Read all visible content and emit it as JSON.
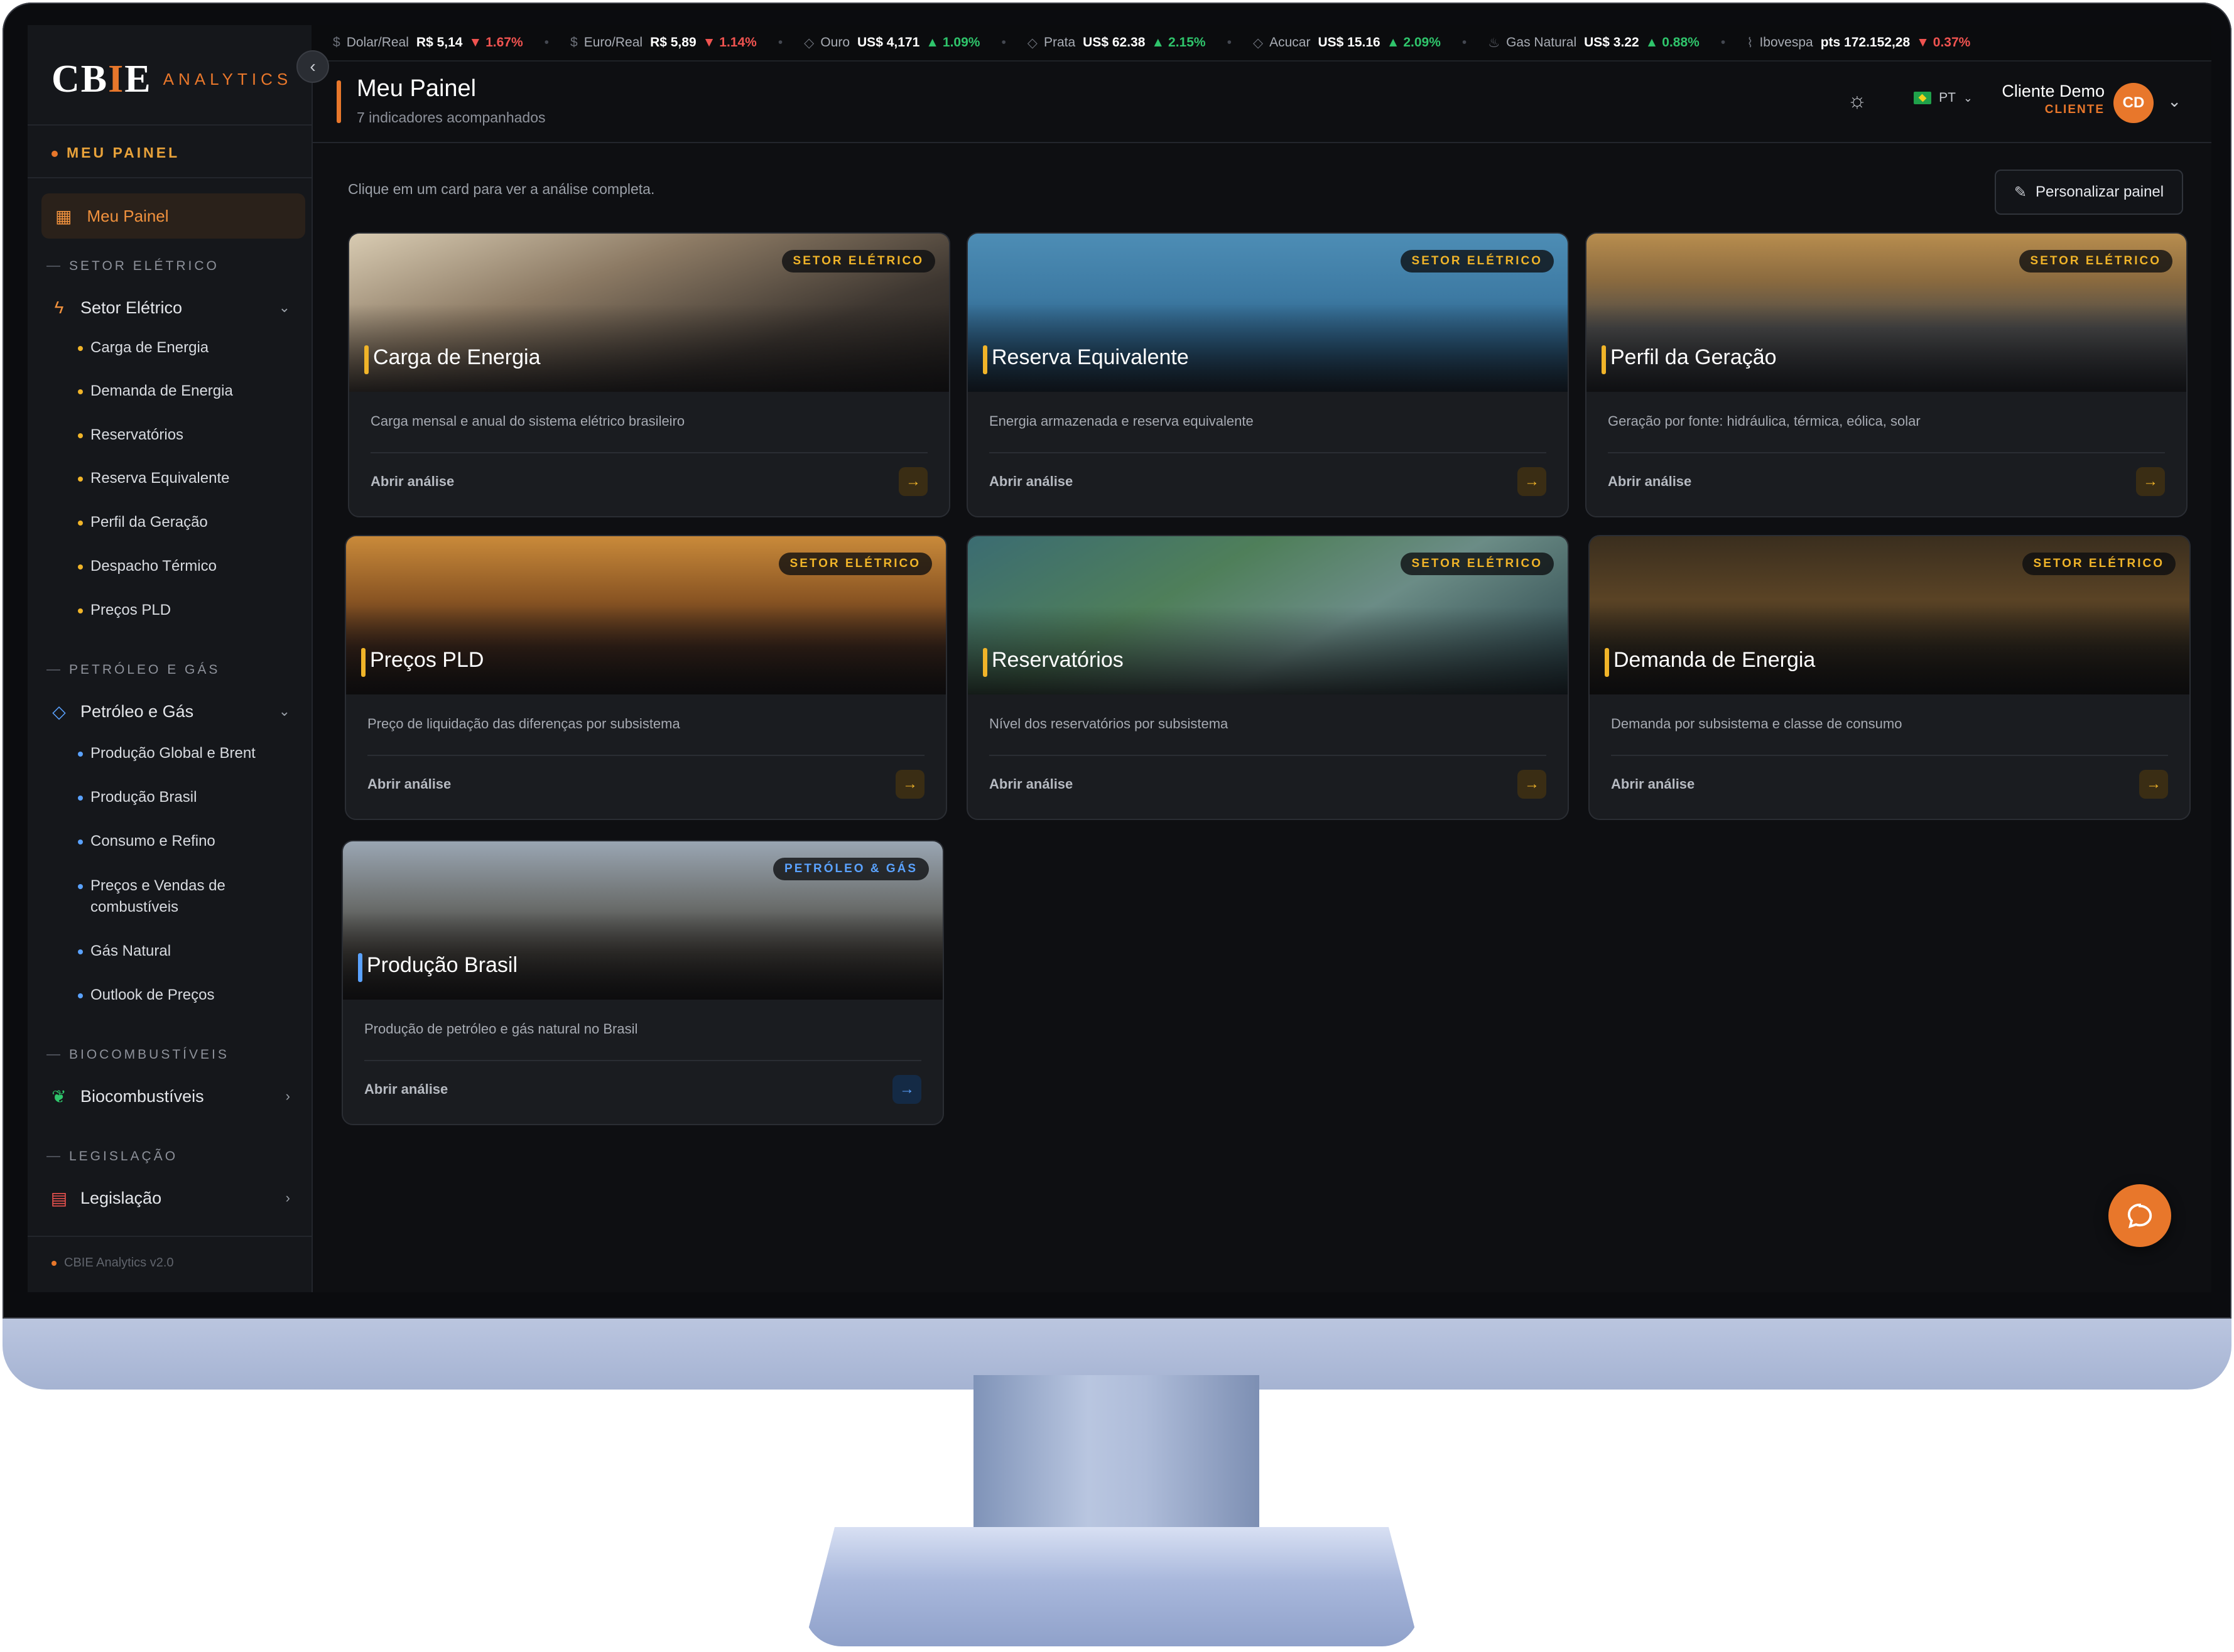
{
  "brand": {
    "logo_text": "CBIE",
    "logo_word": "ANALYTICS",
    "accent": "#e8772b"
  },
  "sidebar": {
    "collapse_icon": "chevron-left-icon",
    "my_section_label": "MEU PAINEL",
    "active_item": {
      "label": "Meu Painel",
      "icon": "grid-icon"
    },
    "groups": [
      {
        "title": "SETOR ELÉTRICO",
        "label": "Setor Elétrico",
        "icon": "bolt-icon",
        "expanded": true,
        "items": [
          "Carga de Energia",
          "Demanda de Energia",
          "Reservatórios",
          "Reserva Equivalente",
          "Perfil da Geração",
          "Despacho Térmico",
          "Preços PLD"
        ]
      },
      {
        "title": "PETRÓLEO E GÁS",
        "label": "Petróleo e Gás",
        "icon": "drop-icon",
        "expanded": true,
        "items": [
          "Produção Global e Brent",
          "Produção Brasil",
          "Consumo e Refino",
          "Preços e Vendas de combustíveis",
          "Gás Natural",
          "Outlook de Preços"
        ]
      },
      {
        "title": "BIOCOMBUSTÍVEIS",
        "label": "Biocombustíveis",
        "icon": "leaf-icon",
        "expanded": false,
        "items": []
      },
      {
        "title": "LEGISLAÇÃO",
        "label": "Legislação",
        "icon": "scroll-icon",
        "expanded": false,
        "items": []
      }
    ],
    "version": "CBIE Analytics v2.0"
  },
  "ticker": [
    {
      "name": "Dolar/Real",
      "value": "R$ 5,14",
      "change": "1.67%",
      "dir": "down",
      "icon": "dollar-icon"
    },
    {
      "name": "Euro/Real",
      "value": "R$ 5,89",
      "change": "1.14%",
      "dir": "down",
      "icon": "dollar-icon"
    },
    {
      "name": "Ouro",
      "value": "US$ 4,171",
      "change": "1.09%",
      "dir": "up",
      "icon": "diamond-icon"
    },
    {
      "name": "Prata",
      "value": "US$ 62.38",
      "change": "2.15%",
      "dir": "up",
      "icon": "diamond-icon"
    },
    {
      "name": "Acucar",
      "value": "US$ 15.16",
      "change": "2.09%",
      "dir": "up",
      "icon": "diamond-icon"
    },
    {
      "name": "Gas Natural",
      "value": "US$ 3.22",
      "change": "0.88%",
      "dir": "up",
      "icon": "flame-icon"
    },
    {
      "name": "Ibovespa",
      "value": "pts 172.152,28",
      "change": "0.37%",
      "dir": "down",
      "icon": "trend-icon"
    }
  ],
  "header": {
    "title": "Meu Painel",
    "subtitle": "7 indicadores acompanhados",
    "lang": "PT",
    "user_name": "Cliente Demo",
    "user_role": "CLIENTE",
    "avatar": "CD"
  },
  "main": {
    "hint": "Clique em um card para ver a análise completa.",
    "customize_label": "Personalizar painel",
    "open_label": "Abrir análise",
    "cards": [
      {
        "title": "Carga de Energia",
        "tag": "SETOR ELÉTRICO",
        "desc": "Carga mensal e anual do sistema elétrico brasileiro",
        "color": "#f0b429"
      },
      {
        "title": "Reserva Equivalente",
        "tag": "SETOR ELÉTRICO",
        "desc": "Energia armazenada e reserva equivalente",
        "color": "#f0b429"
      },
      {
        "title": "Perfil da Geração",
        "tag": "SETOR ELÉTRICO",
        "desc": "Geração por fonte: hidráulica, térmica, eólica, solar",
        "color": "#f0b429"
      },
      {
        "title": "Preços PLD",
        "tag": "SETOR ELÉTRICO",
        "desc": "Preço de liquidação das diferenças por subsistema",
        "color": "#f0b429"
      },
      {
        "title": "Reservatórios",
        "tag": "SETOR ELÉTRICO",
        "desc": "Nível dos reservatórios por subsistema",
        "color": "#f0b429"
      },
      {
        "title": "Demanda de Energia",
        "tag": "SETOR ELÉTRICO",
        "desc": "Demanda por subsistema e classe de consumo",
        "color": "#f0b429"
      },
      {
        "title": "Produção Brasil",
        "tag": "PETRÓLEO & GÁS",
        "desc": "Produção de petróleo e gás natural no Brasil",
        "color": "#5aa2ff"
      }
    ]
  },
  "chat": {
    "icon": "chat-bubble-icon"
  }
}
